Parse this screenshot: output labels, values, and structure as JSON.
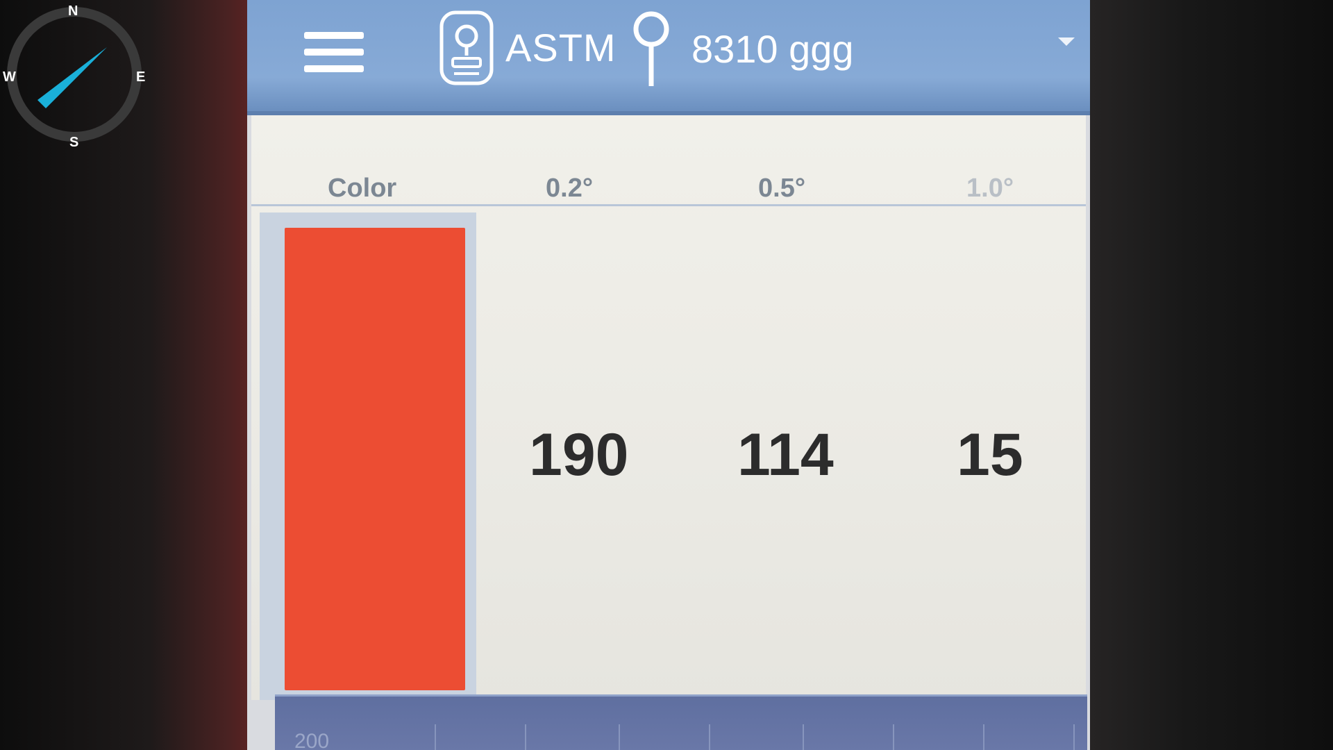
{
  "compass": {
    "north": "N",
    "south": "S",
    "west": "W",
    "east": "E",
    "needle_color": "#1ab0d9",
    "ring_color": "#3a3a3a",
    "icon": "compass-icon"
  },
  "topbar": {
    "menu_icon": "hamburger-menu-icon",
    "device_icon": "device-icon",
    "standard": "ASTM",
    "location_icon": "location-pin-icon",
    "sample": "8310 ggg",
    "dropdown_icon": "chevron-down-icon"
  },
  "table": {
    "headers": [
      "Color",
      "0.2°",
      "0.5°",
      "1.0°"
    ],
    "swatch_color": "#ec4d33",
    "values": [
      "190",
      "114",
      "15"
    ]
  },
  "bottom_chart": {
    "first_label": "200"
  },
  "colors": {
    "topbar": "#87aad6",
    "background": "#ecebe5",
    "text": "#2c2c2c"
  }
}
